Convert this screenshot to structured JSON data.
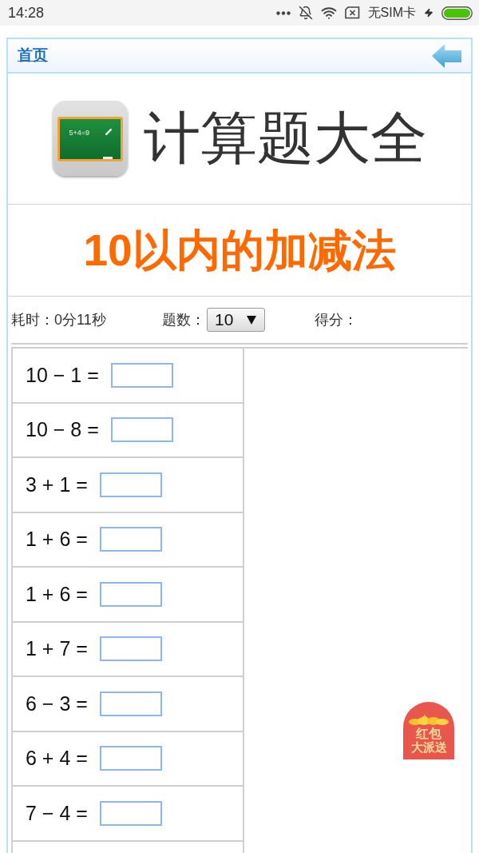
{
  "status_bar": {
    "time": "14:28",
    "carrier": "无SIM卡"
  },
  "header": {
    "home_link": "首页"
  },
  "banner": {
    "icon_text": "5+4=9",
    "title": "计算题大全"
  },
  "section": {
    "title": "10以内的加减法"
  },
  "stats": {
    "time": "耗时：0分11秒",
    "count_label": "题数：",
    "count_value": "10",
    "score_label": "得分："
  },
  "questions": [
    {
      "expression": "10 − 1 ="
    },
    {
      "expression": "10 − 8 ="
    },
    {
      "expression": "3 + 1 ="
    },
    {
      "expression": "1 + 6 ="
    },
    {
      "expression": "1 + 6 ="
    },
    {
      "expression": "1 + 7 ="
    },
    {
      "expression": "6 − 3 ="
    },
    {
      "expression": "6 + 4 ="
    },
    {
      "expression": "7 − 4 ="
    }
  ],
  "promo_button": {
    "lines": [
      "红包",
      "大派送"
    ]
  }
}
